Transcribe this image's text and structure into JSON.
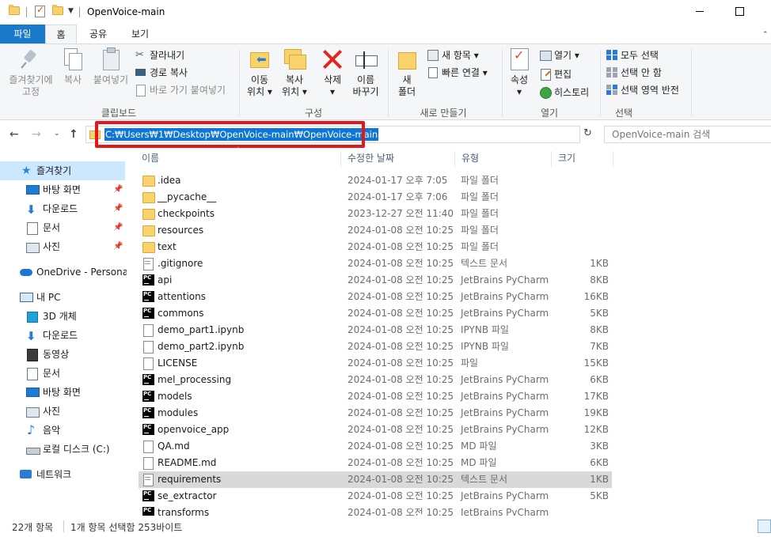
{
  "window": {
    "title": "OpenVoice-main"
  },
  "ribbon_tabs": {
    "file": "파일",
    "home": "홈",
    "share": "공유",
    "view": "보기"
  },
  "ribbon": {
    "clipboard": {
      "group_label": "클립보드",
      "pin_quick_access": [
        "즐겨찾기에",
        "고정"
      ],
      "copy": "복사",
      "paste": "붙여넣기",
      "cut": "잘라내기",
      "copy_path": "경로 복사",
      "paste_shortcut": "바로 가기 붙여넣기"
    },
    "organize": {
      "group_label": "구성",
      "move_to": [
        "이동",
        "위치 ▾"
      ],
      "copy_to": [
        "복사",
        "위치 ▾"
      ],
      "delete": [
        "삭제",
        "▾"
      ],
      "rename": [
        "이름",
        "바꾸기"
      ]
    },
    "new": {
      "group_label": "새로 만들기",
      "new_folder": [
        "새",
        "폴더"
      ],
      "new_item": "새 항목 ▾",
      "easy_access": "빠른 연결 ▾"
    },
    "open": {
      "group_label": "열기",
      "properties": [
        "속성",
        "▾"
      ],
      "open": "열기 ▾",
      "edit": "편집",
      "history": "히스토리"
    },
    "select": {
      "group_label": "선택",
      "select_all": "모두 선택",
      "select_none": "선택 안 함",
      "invert_selection": "선택 영역 반전"
    }
  },
  "address": {
    "path": "C:₩Users₩1₩Desktop₩OpenVoice-main₩OpenVoice-main",
    "search_placeholder": "OpenVoice-main 검색",
    "highlight_color": "#e5161c"
  },
  "navpane": {
    "items": [
      {
        "label": "즐겨찾기",
        "icon": "star-icon",
        "pinned": false
      },
      {
        "label": "바탕 화면",
        "icon": "desktop-icon",
        "pinned": true
      },
      {
        "label": "다운로드",
        "icon": "download-icon",
        "pinned": true
      },
      {
        "label": "문서",
        "icon": "documents-icon",
        "pinned": true
      },
      {
        "label": "사진",
        "icon": "pictures-icon",
        "pinned": true
      },
      {
        "label": "OneDrive - Personal",
        "icon": "onedrive-icon",
        "pinned": false
      },
      {
        "label": "내 PC",
        "icon": "this-pc-icon",
        "pinned": false
      },
      {
        "label": "3D 개체",
        "icon": "3d-objects-icon",
        "pinned": false
      },
      {
        "label": "다운로드",
        "icon": "download-icon",
        "pinned": false
      },
      {
        "label": "동영상",
        "icon": "videos-icon",
        "pinned": false
      },
      {
        "label": "문서",
        "icon": "documents-icon",
        "pinned": false
      },
      {
        "label": "바탕 화면",
        "icon": "desktop-icon",
        "pinned": false
      },
      {
        "label": "사진",
        "icon": "pictures-icon",
        "pinned": false
      },
      {
        "label": "음악",
        "icon": "music-icon",
        "pinned": false
      },
      {
        "label": "로컬 디스크 (C:)",
        "icon": "drive-icon",
        "pinned": false
      },
      {
        "label": "네트워크",
        "icon": "network-icon",
        "pinned": false
      }
    ]
  },
  "filelist": {
    "columns": {
      "name": "이름",
      "modified": "수정한 날짜",
      "type": "유형",
      "size": "크기"
    },
    "rows": [
      {
        "name": ".idea",
        "modified": "2024-01-17 오후 7:05",
        "type": "파일 폴더",
        "size": "",
        "icon": "folder"
      },
      {
        "name": "__pycache__",
        "modified": "2024-01-17 오후 7:06",
        "type": "파일 폴더",
        "size": "",
        "icon": "folder"
      },
      {
        "name": "checkpoints",
        "modified": "2023-12-27 오전 11:40",
        "type": "파일 폴더",
        "size": "",
        "icon": "folder"
      },
      {
        "name": "resources",
        "modified": "2024-01-08 오전 10:25",
        "type": "파일 폴더",
        "size": "",
        "icon": "folder"
      },
      {
        "name": "text",
        "modified": "2024-01-08 오전 10:25",
        "type": "파일 폴더",
        "size": "",
        "icon": "folder"
      },
      {
        "name": ".gitignore",
        "modified": "2024-01-08 오전 10:25",
        "type": "텍스트 문서",
        "size": "1KB",
        "icon": "doc"
      },
      {
        "name": "api",
        "modified": "2024-01-08 오전 10:25",
        "type": "JetBrains PyCharm",
        "size": "8KB",
        "icon": "pycharm"
      },
      {
        "name": "attentions",
        "modified": "2024-01-08 오전 10:25",
        "type": "JetBrains PyCharm",
        "size": "16KB",
        "icon": "pycharm"
      },
      {
        "name": "commons",
        "modified": "2024-01-08 오전 10:25",
        "type": "JetBrains PyCharm",
        "size": "5KB",
        "icon": "pycharm"
      },
      {
        "name": "demo_part1.ipynb",
        "modified": "2024-01-08 오전 10:25",
        "type": "IPYNB 파일",
        "size": "8KB",
        "icon": "blank"
      },
      {
        "name": "demo_part2.ipynb",
        "modified": "2024-01-08 오전 10:25",
        "type": "IPYNB 파일",
        "size": "7KB",
        "icon": "blank"
      },
      {
        "name": "LICENSE",
        "modified": "2024-01-08 오전 10:25",
        "type": "파일",
        "size": "15KB",
        "icon": "blank"
      },
      {
        "name": "mel_processing",
        "modified": "2024-01-08 오전 10:25",
        "type": "JetBrains PyCharm",
        "size": "6KB",
        "icon": "pycharm"
      },
      {
        "name": "models",
        "modified": "2024-01-08 오전 10:25",
        "type": "JetBrains PyCharm",
        "size": "17KB",
        "icon": "pycharm"
      },
      {
        "name": "modules",
        "modified": "2024-01-08 오전 10:25",
        "type": "JetBrains PyCharm",
        "size": "19KB",
        "icon": "pycharm"
      },
      {
        "name": "openvoice_app",
        "modified": "2024-01-08 오전 10:25",
        "type": "JetBrains PyCharm",
        "size": "12KB",
        "icon": "pycharm"
      },
      {
        "name": "QA.md",
        "modified": "2024-01-08 오전 10:25",
        "type": "MD 파일",
        "size": "3KB",
        "icon": "blank"
      },
      {
        "name": "README.md",
        "modified": "2024-01-08 오전 10:25",
        "type": "MD 파일",
        "size": "6KB",
        "icon": "blank"
      },
      {
        "name": "requirements",
        "modified": "2024-01-08 오전 10:25",
        "type": "텍스트 문서",
        "size": "1KB",
        "icon": "doc",
        "selected": true
      },
      {
        "name": "se_extractor",
        "modified": "2024-01-08 오전 10:25",
        "type": "JetBrains PyCharm",
        "size": "5KB",
        "icon": "pycharm"
      },
      {
        "name": "transforms",
        "modified": "2024-01-08 오전 10:25",
        "type": "JetBrains PyCharm",
        "size": "",
        "icon": "pycharm"
      }
    ]
  },
  "status": {
    "item_count": "22개 항목",
    "selection": "1개 항목 선택함 253바이트"
  },
  "colors": {
    "accent": "#1979ca",
    "selection": "#cce8ff",
    "address_selection": "#0f76d4"
  }
}
